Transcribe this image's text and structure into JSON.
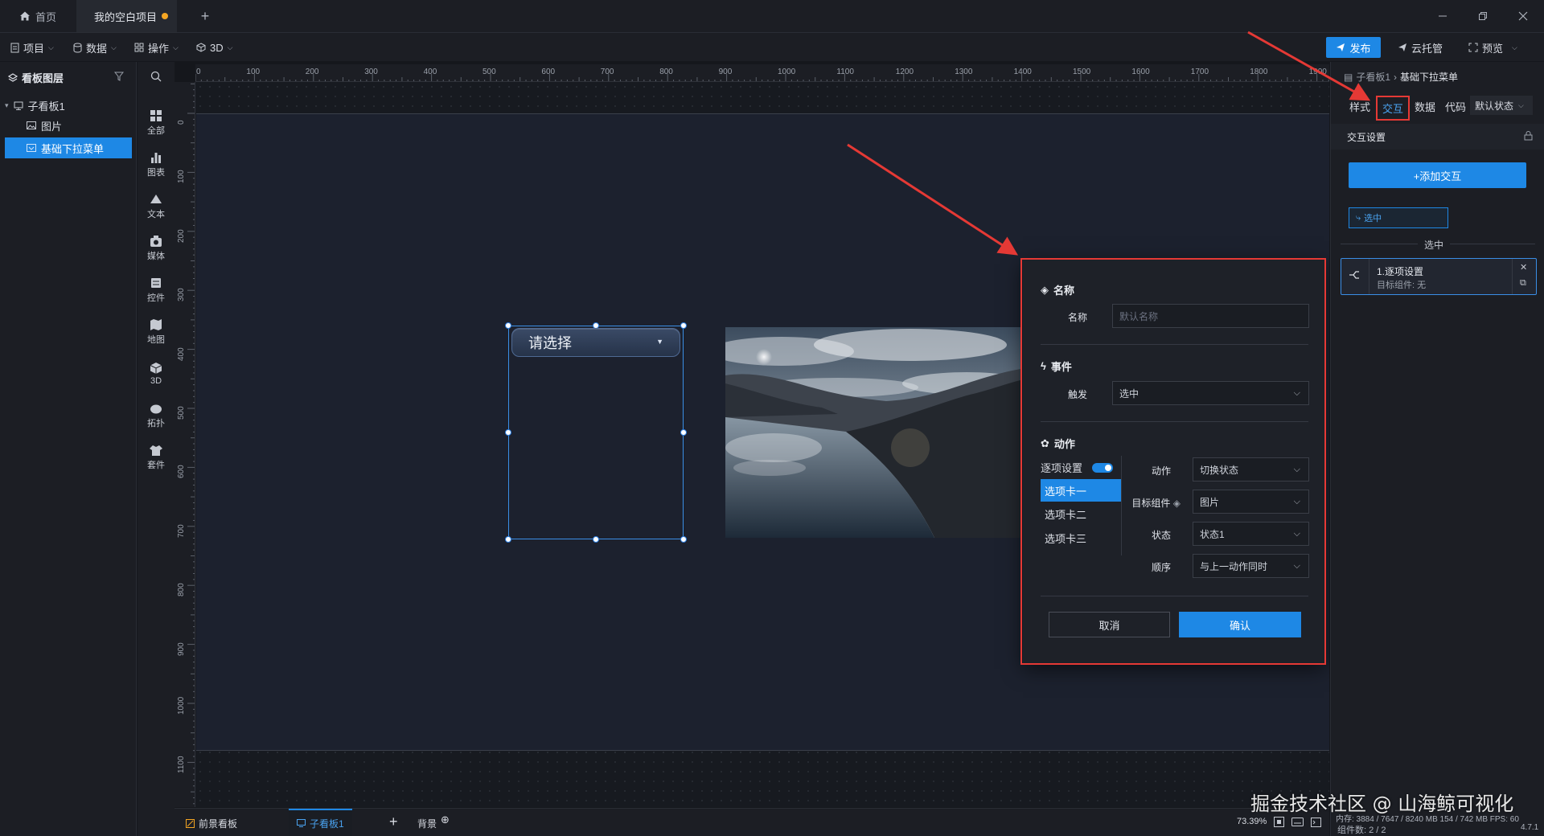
{
  "tabs": {
    "home": "首页",
    "project": "我的空白项目"
  },
  "menu": {
    "project": "项目",
    "data": "数据",
    "operate": "操作",
    "threed": "3D",
    "publish": "发布",
    "cloud": "云托管",
    "preview": "预览"
  },
  "layers": {
    "title": "看板图层",
    "items": [
      {
        "label": "子看板1"
      },
      {
        "label": "图片"
      },
      {
        "label": "基础下拉菜单"
      }
    ]
  },
  "tools": [
    {
      "label": "全部",
      "icon": "grid-icon"
    },
    {
      "label": "图表",
      "icon": "bar-chart-icon"
    },
    {
      "label": "文本",
      "icon": "text-icon"
    },
    {
      "label": "媒体",
      "icon": "media-icon"
    },
    {
      "label": "控件",
      "icon": "control-icon"
    },
    {
      "label": "地图",
      "icon": "map-icon"
    },
    {
      "label": "3D",
      "icon": "cube-icon"
    },
    {
      "label": "拓扑",
      "icon": "topology-icon"
    },
    {
      "label": "套件",
      "icon": "kit-icon"
    }
  ],
  "ruler": {
    "top": [
      "0",
      "100",
      "200",
      "300",
      "400",
      "500",
      "600",
      "700",
      "800",
      "900",
      "1000",
      "1100",
      "1200",
      "1300",
      "1400",
      "1500",
      "1600",
      "1700",
      "1800",
      "1900"
    ],
    "left": [
      "0",
      "100",
      "200",
      "300",
      "400",
      "500",
      "600",
      "700",
      "800",
      "900",
      "1000",
      "1100"
    ]
  },
  "canvas": {
    "dropdown_placeholder": "请选择"
  },
  "bottom": {
    "foreground": "前景看板",
    "sub_board": "子看板1",
    "background": "背景",
    "zoom": "73.39%",
    "status": "内存: 3884 / 7647 / 8240 MB 154 / 742 MB FPS: 60",
    "components": "组件数: 2 / 2",
    "version": "4.7.1"
  },
  "modal": {
    "name_section": "名称",
    "name_label": "名称",
    "name_placeholder": "默认名称",
    "event_section": "事件",
    "trigger_label": "触发",
    "trigger_value": "选中",
    "action_section": "动作",
    "per_option_label": "逐项设置",
    "options": [
      "选项卡一",
      "选项卡二",
      "选项卡三"
    ],
    "action_label": "动作",
    "action_value": "切换状态",
    "target_label": "目标组件",
    "target_value": "图片",
    "state_label": "状态",
    "state_value": "状态1",
    "order_label": "顺序",
    "order_value": "与上一动作同时",
    "cancel": "取消",
    "confirm": "确认"
  },
  "rightpanel": {
    "breadcrumb_parent": "子看板1",
    "breadcrumb_current": "基础下拉菜单",
    "tabs": [
      "样式",
      "交互",
      "数据",
      "代码"
    ],
    "state_select": "默认状态",
    "section_title": "交互设置",
    "add_button": "+添加交互",
    "chip": "选中",
    "divider_label": "选中",
    "card_title": "1.逐项设置",
    "card_sub": "目标组件: 无"
  },
  "watermark": "掘金技术社区 @ 山海鲸可视化",
  "colors": {
    "accent": "#1e88e5",
    "annotation": "#e53935",
    "board": "#1c212e"
  }
}
